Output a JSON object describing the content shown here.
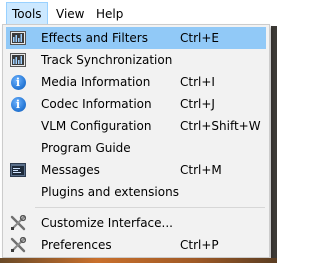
{
  "menubar": {
    "tools": "Tools",
    "view": "View",
    "help": "Help"
  },
  "menu": {
    "items": [
      {
        "label": "Effects and Filters",
        "shortcut": "Ctrl+E",
        "icon": "equalizer-icon",
        "highlighted": true
      },
      {
        "label": "Track Synchronization",
        "shortcut": "",
        "icon": "equalizer-icon"
      },
      {
        "label": "Media Information",
        "shortcut": "Ctrl+I",
        "icon": "info-icon"
      },
      {
        "label": "Codec Information",
        "shortcut": "Ctrl+J",
        "icon": "info-icon"
      },
      {
        "label": "VLM Configuration",
        "shortcut": "Ctrl+Shift+W",
        "icon": ""
      },
      {
        "label": "Program Guide",
        "shortcut": "",
        "icon": ""
      },
      {
        "label": "Messages",
        "shortcut": "Ctrl+M",
        "icon": "terminal-icon"
      },
      {
        "label": "Plugins and extensions",
        "shortcut": "",
        "icon": ""
      },
      {
        "label": "Customize Interface...",
        "shortcut": "",
        "icon": "wrench-screwdriver-icon"
      },
      {
        "label": "Preferences",
        "shortcut": "Ctrl+P",
        "icon": "wrench-screwdriver-icon"
      }
    ]
  },
  "colors": {
    "highlight": "#91c9f7",
    "menu_bg": "#f2f2f2",
    "menubar_active": "#cce8ff"
  }
}
